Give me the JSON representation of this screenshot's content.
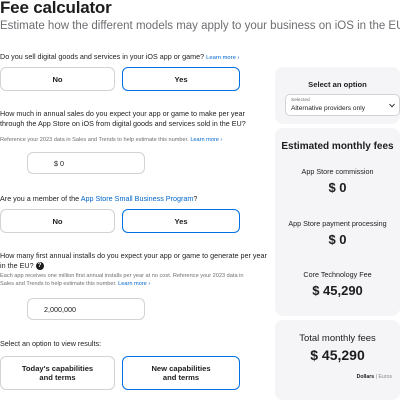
{
  "header": {
    "title": "Fee calculator",
    "subtitle": "Estimate how the different models may apply to your business on iOS in the EU."
  },
  "q1": {
    "question": "Do you sell digital goods and services in your iOS app or game?",
    "learn_more": "Learn more ›",
    "options": [
      "No",
      "Yes"
    ],
    "selected": "Yes"
  },
  "q2": {
    "question": "How much in annual sales do you expect your app or game to make per year through the App Store on iOS from digital goods and services sold in the EU?",
    "help": "Reference your 2023 data in Sales and Trends to help estimate this number.",
    "learn_more": "Learn more ›",
    "value": "$ 0"
  },
  "q3": {
    "question_prefix": "Are you a member of the",
    "link": "App Store Small Business Program",
    "question_suffix": "?",
    "options": [
      "No",
      "Yes"
    ],
    "selected": "Yes"
  },
  "q4": {
    "question": "How many first annual installs do you expect your app or game to generate per year in the EU?",
    "help": "Each app receives one million first annual installs per year at no cost. Reference your 2023 data in Sales and Trends to help estimate this number.",
    "learn_more": "Learn more ›",
    "value": "2,000,000"
  },
  "results_select": {
    "prompt": "Select an option to view results:",
    "options": [
      "Today's capabilities and terms",
      "New capabilities and terms"
    ],
    "selected": "New capabilities and terms"
  },
  "sidebar": {
    "select_heading": "Select an option",
    "dropdown_label": "Selected",
    "dropdown_value": "Alternative providers only",
    "fees_heading": "Estimated monthly fees",
    "fees": [
      {
        "label": "App Store commission",
        "value": "$ 0"
      },
      {
        "label": "App Store payment processing",
        "value": "$ 0"
      },
      {
        "label": "Core Technology Fee",
        "value": "$ 45,290"
      }
    ],
    "total_label": "Total monthly fees",
    "total_value": "$ 45,290",
    "currency_options": [
      "Dollars",
      "Euros"
    ],
    "currency_selected": "Dollars"
  }
}
